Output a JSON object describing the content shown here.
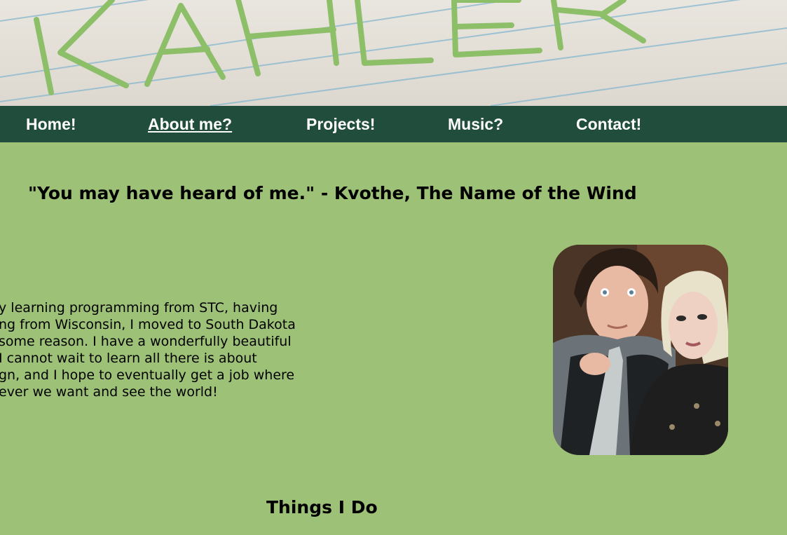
{
  "banner": {
    "logo_text": "KAHLER"
  },
  "nav": {
    "items": [
      {
        "label": "Home!"
      },
      {
        "label": "About me?"
      },
      {
        "label": "Projects!"
      },
      {
        "label": "Music?"
      },
      {
        "label": "Contact!"
      }
    ],
    "active_index": 1
  },
  "quote": "\"You may have heard of me.\" - Kvothe, The Name of the Wind",
  "about": {
    "lines": [
      "y learning programming from STC, having",
      "ng from Wisconsin, I moved to South Dakota",
      "some reason. I have a wonderfully beautiful",
      " I cannot wait to learn all there is about",
      "gn, and I hope to eventually get a job where",
      "ever we want and see the world!"
    ]
  },
  "sections": {
    "things_heading": "Things I Do"
  },
  "colors": {
    "page_background": "#9dc277",
    "nav_background": "#214d3c",
    "logo_green": "#8dbe68",
    "text": "#000000"
  }
}
